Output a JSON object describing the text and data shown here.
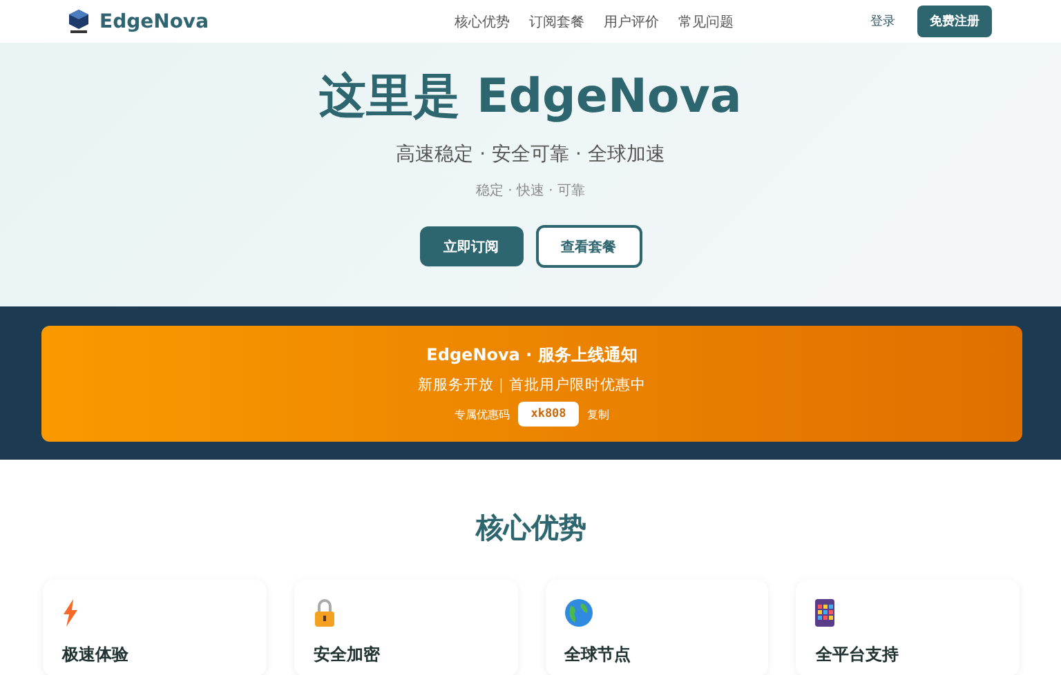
{
  "nav": {
    "brand": "EdgeNova",
    "links": [
      "核心优势",
      "订阅套餐",
      "用户评价",
      "常见问题"
    ],
    "login": "登录",
    "signup": "免费注册"
  },
  "hero": {
    "title": "这里是 EdgeNova",
    "subtitle": "高速稳定 · 安全可靠 · 全球加速",
    "tagline": "稳定 · 快速 · 可靠",
    "primary": "立即订阅",
    "secondary": "查看套餐"
  },
  "notice": {
    "title": "EdgeNova · 服务上线通知",
    "text": "新服务开放｜首批用户限时优惠中",
    "code_label": "专属优惠码",
    "code": "xk808",
    "copy": "复制"
  },
  "features": {
    "title": "核心优势",
    "cards": [
      {
        "kind": "bolt",
        "title": "极速体验"
      },
      {
        "kind": "lock",
        "title": "安全加密"
      },
      {
        "kind": "globe",
        "title": "全球节点"
      },
      {
        "kind": "apps",
        "title": "全平台支持"
      }
    ]
  }
}
